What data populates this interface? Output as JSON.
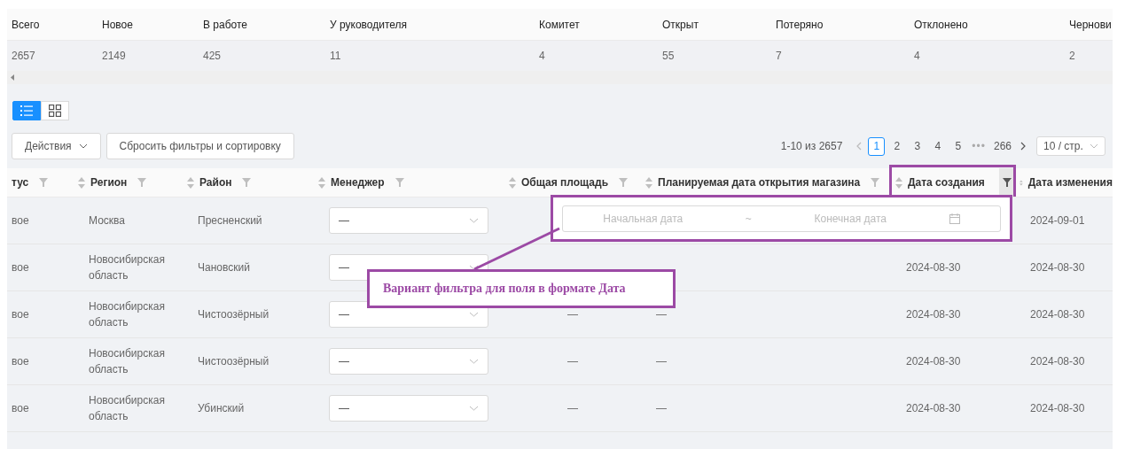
{
  "summary": {
    "columns": [
      "Всего",
      "Новое",
      "В работе",
      "У руководителя",
      "Комитет",
      "Открыт",
      "Потеряно",
      "Отклонено",
      "Чернови"
    ],
    "values": [
      "2657",
      "2149",
      "425",
      "11",
      "4",
      "55",
      "7",
      "4",
      "2"
    ]
  },
  "view_toggle": [
    {
      "kind": "list",
      "selected": true
    },
    {
      "kind": "grid",
      "selected": false
    }
  ],
  "toolbar": {
    "actions": "Действия",
    "reset": "Сбросить фильтры и сортировку"
  },
  "pagination": {
    "range": "1-10 из 2657",
    "pages": [
      {
        "label": "1",
        "selected": true
      },
      {
        "label": "2",
        "selected": false
      },
      {
        "label": "3",
        "selected": false
      },
      {
        "label": "4",
        "selected": false
      },
      {
        "label": "5",
        "selected": false
      }
    ],
    "ellipsis": "•••",
    "last": "266",
    "page_size": "10 / стр."
  },
  "table": {
    "columns": [
      {
        "label": "тус",
        "filter_active": false
      },
      {
        "label": "Регион",
        "filter_active": false
      },
      {
        "label": "Район",
        "filter_active": false
      },
      {
        "label": "Менеджер",
        "filter_active": false
      },
      {
        "label": "Общая площадь",
        "filter_active": false
      },
      {
        "label": "Планируемая дата открытия магазина",
        "filter_active": false
      },
      {
        "label": "Дата создания",
        "filter_active": true
      },
      {
        "label": "Дата изменения"
      }
    ],
    "rows": [
      {
        "status": "вое",
        "region": "Москва",
        "district": "Пресненский",
        "manager": "—",
        "modified": "2024-09-01"
      },
      {
        "status": "вое",
        "region": "Новосибирская область",
        "district": "Чановский",
        "manager": "—",
        "created": "2024-08-30",
        "modified": "2024-08-30"
      },
      {
        "status": "вое",
        "region": "Новосибирская область",
        "district": "Чистоозёрный",
        "manager": "—",
        "area": "—",
        "planned": "—",
        "created": "2024-08-30",
        "modified": "2024-08-30"
      },
      {
        "status": "вое",
        "region": "Новосибирская область",
        "district": "Чистоозёрный",
        "manager": "—",
        "area": "—",
        "planned": "—",
        "created": "2024-08-30",
        "modified": "2024-08-30"
      },
      {
        "status": "вое",
        "region": "Новосибирская область",
        "district": "Убинский",
        "manager": "—",
        "area": "—",
        "planned": "—",
        "created": "2024-08-30",
        "modified": "2024-08-30"
      }
    ]
  },
  "date_filter": {
    "start_placeholder": "Начальная дата",
    "separator": "~",
    "end_placeholder": "Конечная дата"
  },
  "annotation": {
    "text": "Вариант фильтра для поля в формате Дата"
  }
}
